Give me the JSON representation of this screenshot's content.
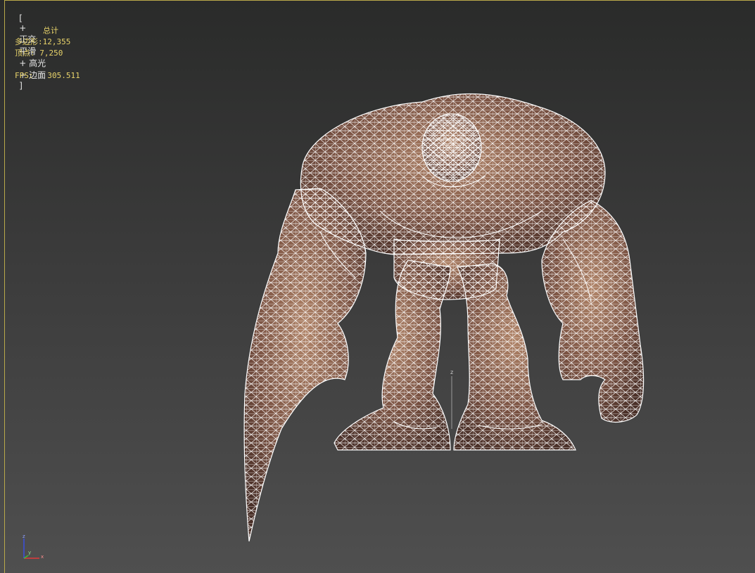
{
  "viewport": {
    "label": {
      "open": "[",
      "plus": "+",
      "view": "正交",
      "shading": "平滑",
      "highlight": "+ 高光",
      "edges": "+ 边面",
      "close": "]"
    },
    "stats": {
      "title": "总计",
      "polygons_label": "多边形:",
      "polygons_value": "12,355",
      "vertices_label": "顶点:",
      "vertices_value": "7,250",
      "fps_label": "FPS:",
      "fps_value": "305.511"
    },
    "axis_gizmo": {
      "x": "x",
      "y": "y",
      "z": "z"
    },
    "center_marker": "z"
  },
  "colors": {
    "accent_border": "#b9a94a",
    "stats_text": "#e8d36a",
    "label_text": "#e6e6e6",
    "wire": "#ffffff",
    "skin_dark": "#5a3a2e",
    "skin_light": "#a97b63"
  }
}
